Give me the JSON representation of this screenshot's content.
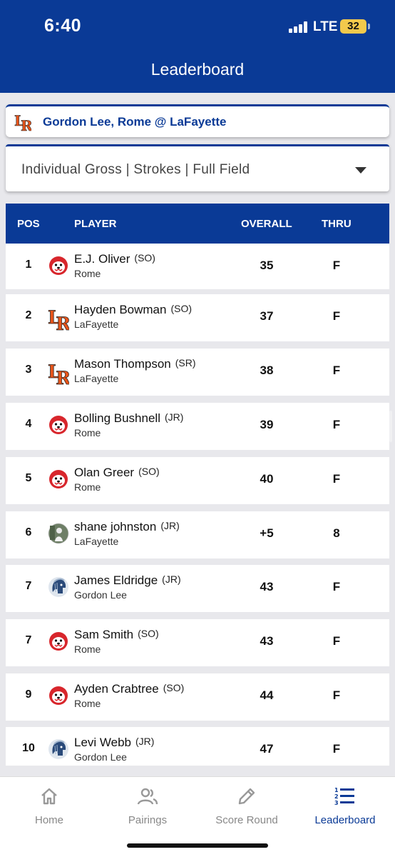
{
  "status_bar": {
    "time": "6:40",
    "network": "LTE",
    "battery": "32"
  },
  "header": {
    "title": "Leaderboard"
  },
  "event": {
    "name": "Gordon Lee, Rome @ LaFayette"
  },
  "filter": {
    "value": "Individual Gross | Strokes | Full Field"
  },
  "table": {
    "columns": {
      "pos": "POS",
      "player": "PLAYER",
      "overall": "OVERALL",
      "thru": "THRU"
    },
    "rows": [
      {
        "pos": "1",
        "name": "E.J. Oliver",
        "year": "(SO)",
        "team": "Rome",
        "logo": "rome-wolf-icon",
        "overall": "35",
        "thru": "F"
      },
      {
        "pos": "2",
        "name": "Hayden Bowman",
        "year": "(SO)",
        "team": "LaFayette",
        "logo": "lafayette-lr-icon",
        "overall": "37",
        "thru": "F"
      },
      {
        "pos": "3",
        "name": "Mason Thompson",
        "year": "(SR)",
        "team": "LaFayette",
        "logo": "lafayette-lr-icon",
        "overall": "38",
        "thru": "F"
      },
      {
        "pos": "4",
        "name": "Bolling Bushnell",
        "year": "(JR)",
        "team": "Rome",
        "logo": "rome-wolf-icon",
        "overall": "39",
        "thru": "F"
      },
      {
        "pos": "5",
        "name": "Olan Greer",
        "year": "(SO)",
        "team": "Rome",
        "logo": "rome-wolf-icon",
        "overall": "40",
        "thru": "F"
      },
      {
        "pos": "6",
        "name": "shane johnston",
        "year": "(JR)",
        "team": "LaFayette",
        "logo": "player-photo-avatar",
        "overall": "+5",
        "thru": "8"
      },
      {
        "pos": "7",
        "name": "James Eldridge",
        "year": "(JR)",
        "team": "Gordon Lee",
        "logo": "gordon-lee-trojan-icon",
        "overall": "43",
        "thru": "F"
      },
      {
        "pos": "7",
        "name": "Sam Smith",
        "year": "(SO)",
        "team": "Rome",
        "logo": "rome-wolf-icon",
        "overall": "43",
        "thru": "F"
      },
      {
        "pos": "9",
        "name": "Ayden Crabtree",
        "year": "(SO)",
        "team": "Rome",
        "logo": "rome-wolf-icon",
        "overall": "44",
        "thru": "F"
      },
      {
        "pos": "10",
        "name": "Levi Webb",
        "year": "(JR)",
        "team": "Gordon Lee",
        "logo": "gordon-lee-trojan-icon",
        "overall": "47",
        "thru": "F"
      }
    ]
  },
  "tabs": [
    {
      "label": "Home",
      "icon": "home-icon",
      "active": false
    },
    {
      "label": "Pairings",
      "icon": "people-icon",
      "active": false
    },
    {
      "label": "Score Round",
      "icon": "pencil-icon",
      "active": false
    },
    {
      "label": "Leaderboard",
      "icon": "leaderboard-list-icon",
      "active": true
    }
  ],
  "colors": {
    "brand": "#0a3a96",
    "rome_red": "#d8262c",
    "lafayette_orange": "#e8541a",
    "gordon_lee": "#2a4a7a"
  }
}
